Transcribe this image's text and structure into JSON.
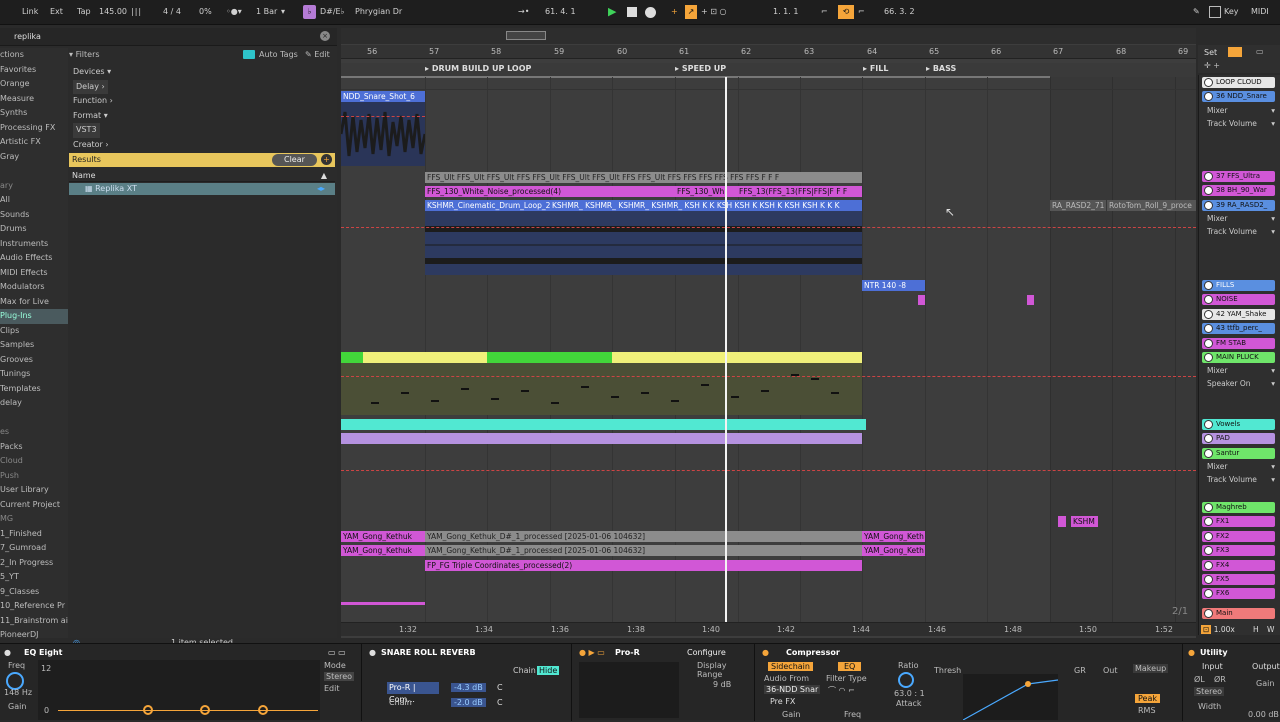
{
  "transport": {
    "link": "Link",
    "ext": "Ext",
    "tap": "Tap",
    "tempo": "145.00",
    "signature": "4 / 4",
    "cpu": "0%",
    "quantize": "1 Bar",
    "key": "D#/E♭",
    "scale": "Phrygian Dr",
    "position": "61. 4. 1",
    "loop_start": "1. 1. 1",
    "loop_length": "66. 3. 2",
    "key_label": "Key",
    "midi_label": "MIDI"
  },
  "browser": {
    "search": "replika",
    "places": [
      "ctions",
      "Favorites",
      "Orange",
      "Measure",
      "Synths",
      "Processing FX",
      "Artistic FX",
      "Gray",
      "",
      "ary",
      "All",
      "Sounds",
      "Drums",
      "Instruments",
      "Audio Effects",
      "MIDI Effects",
      "Modulators",
      "Max for Live",
      "Plug-Ins",
      "Clips",
      "Samples",
      "Grooves",
      "Tunings",
      "Templates",
      "delay",
      "",
      "es",
      "Packs",
      "Cloud",
      "Push",
      "User Library",
      "Current Project",
      "MG",
      "1_Finished",
      "7_Gumroad",
      "2_In Progress",
      "5_YT",
      "9_Classes",
      "10_Reference Pr",
      "11_Brainstrom ai",
      "PioneerDJ"
    ],
    "filters_label": "Filters",
    "auto_tags": "Auto Tags",
    "edit": "Edit",
    "filter_rows": [
      "Devices ▾",
      "Delay ›",
      "Function ›",
      "Format ▾",
      "VST3",
      "Creator ›"
    ],
    "results_label": "Results",
    "clear_label": "Clear",
    "name_header": "Name",
    "result_item": "Replika XT",
    "status": "1 item selected"
  },
  "ruler": {
    "bars": [
      "56",
      "57",
      "58",
      "59",
      "60",
      "61",
      "62",
      "63",
      "64",
      "65",
      "66",
      "67",
      "68",
      "69"
    ],
    "times": [
      "1:32",
      "1:34",
      "1:36",
      "1:38",
      "1:40",
      "1:42",
      "1:44",
      "1:46",
      "1:48",
      "1:50",
      "1:52"
    ]
  },
  "locators": [
    "DRUM BUILD UP LOOP",
    "SPEED UP",
    "FILL",
    "BASS"
  ],
  "clips": {
    "snare": "NDD_Snare_Shot_6",
    "ffs_row": "FFS_Ult FFS_Ult FFS_Ult FFS FFS_Ult FFS_Ult FFS_Ult FFS FFS_Ult FFS FFS FFS FFS FFS FFS F F F",
    "white_noise": "FFS_130_White_Noise_processed(4)",
    "white_noise_b": "FFS_130_Wh",
    "white_noise_c": "FFS_13(FFS_13(FFS|FFS|F F F",
    "cinematic": "KSHMR_Cinematic_Drum_Loop_2",
    "cinematic_rest": "KSHMR_ KSHMR_ KSHMR_ KSHMR_ KSH K K KSH KSH K KSH K KSH KSH K K K",
    "rasd": "RA_RASD2_71",
    "roto": "RotoTom_Roll_9_proce",
    "ntr": "NTR 140 -8",
    "gong1": "YAM_Gong_Kethuk",
    "gong_long": "YAM_Gong_Kethuk_D#_1_processed [2025-01-06 104632]",
    "gong_end": "YAM_Gong_Keth",
    "triple": "FP_FG Triple Coordinates_processed(2)",
    "kshm": "KSHM",
    "page": "2/1"
  },
  "mixer": {
    "tracks": [
      {
        "name": "LOOP CLOUD",
        "color": "#e6e6e6"
      },
      {
        "name": "36 NDD_Snare",
        "color": "#5a8fe0"
      },
      {
        "name": "37 FFS_Ultra",
        "color": "#d157d6"
      },
      {
        "name": "38 BH_90_War",
        "color": "#d157d6"
      },
      {
        "name": "39 RA_RASD2_",
        "color": "#5a8fe0"
      },
      {
        "name": "FILLS",
        "color": "#5a8fe0"
      },
      {
        "name": "NOISE",
        "color": "#d157d6"
      },
      {
        "name": "42 YAM_Shake",
        "color": "#e6e6e6"
      },
      {
        "name": "43 ttfb_perc_",
        "color": "#5a8fe0"
      },
      {
        "name": "FM STAB",
        "color": "#d157d6"
      },
      {
        "name": "MAIN PLUCK",
        "color": "#6fe56a"
      },
      {
        "name": "Vowels",
        "color": "#51e8d2"
      },
      {
        "name": "PAD",
        "color": "#b592e0"
      },
      {
        "name": "Santur",
        "color": "#6fe56a"
      },
      {
        "name": "Maghreb",
        "color": "#6fe56a"
      },
      {
        "name": "FX1",
        "color": "#d157d6"
      },
      {
        "name": "FX2",
        "color": "#d157d6"
      },
      {
        "name": "FX3",
        "color": "#d157d6"
      },
      {
        "name": "FX4",
        "color": "#d157d6"
      },
      {
        "name": "FX5",
        "color": "#d157d6"
      },
      {
        "name": "FX6",
        "color": "#d157d6"
      },
      {
        "name": "Main",
        "color": "#f07a7a"
      }
    ],
    "mixer_label": "Mixer",
    "track_volume": "Track Volume",
    "speaker_on": "Speaker On",
    "set_label": "Set",
    "zoom": "1.00x",
    "h": "H",
    "w": "W"
  },
  "devices": {
    "eq": {
      "title": "EQ Eight",
      "freq": "Freq",
      "freq_val": "148 Hz",
      "gain": "Gain",
      "scale12": "12",
      "scale0": "0",
      "mode": "Mode",
      "stereo": "Stereo",
      "edit": "Edit"
    },
    "rack": {
      "title": "SNARE ROLL REVERB",
      "chain": "Chain",
      "hide": "Hide",
      "pror": "Pro-R | Com...",
      "chain2": "Chain",
      "v1": "-4.3 dB",
      "v2": "-2.0 dB",
      "c": "C"
    },
    "pror": {
      "title": "Pro-R",
      "configure": "Configure",
      "display_range": "Display Range",
      "db": "9 dB"
    },
    "comp": {
      "title": "Compressor",
      "sidechain": "Sidechain",
      "eq": "EQ",
      "audio_from": "Audio From",
      "source": "36-NDD Snar",
      "prefx": "Pre FX",
      "gain": "Gain",
      "filter_type": "Filter Type",
      "freq": "Freq",
      "ratio": "Ratio",
      "ratio_val": "63.0 : 1",
      "attack": "Attack",
      "thresh": "Thresh",
      "gr": "GR",
      "out": "Out",
      "makeup": "Makeup",
      "peak": "Peak",
      "rms": "RMS"
    },
    "utility": {
      "title": "Utility",
      "input": "Input",
      "output": "Output",
      "l": "ØL",
      "r": "ØR",
      "stereo": "Stereo",
      "width": "Width",
      "gain": "Gain",
      "gain_val": "0.00 dB"
    }
  }
}
